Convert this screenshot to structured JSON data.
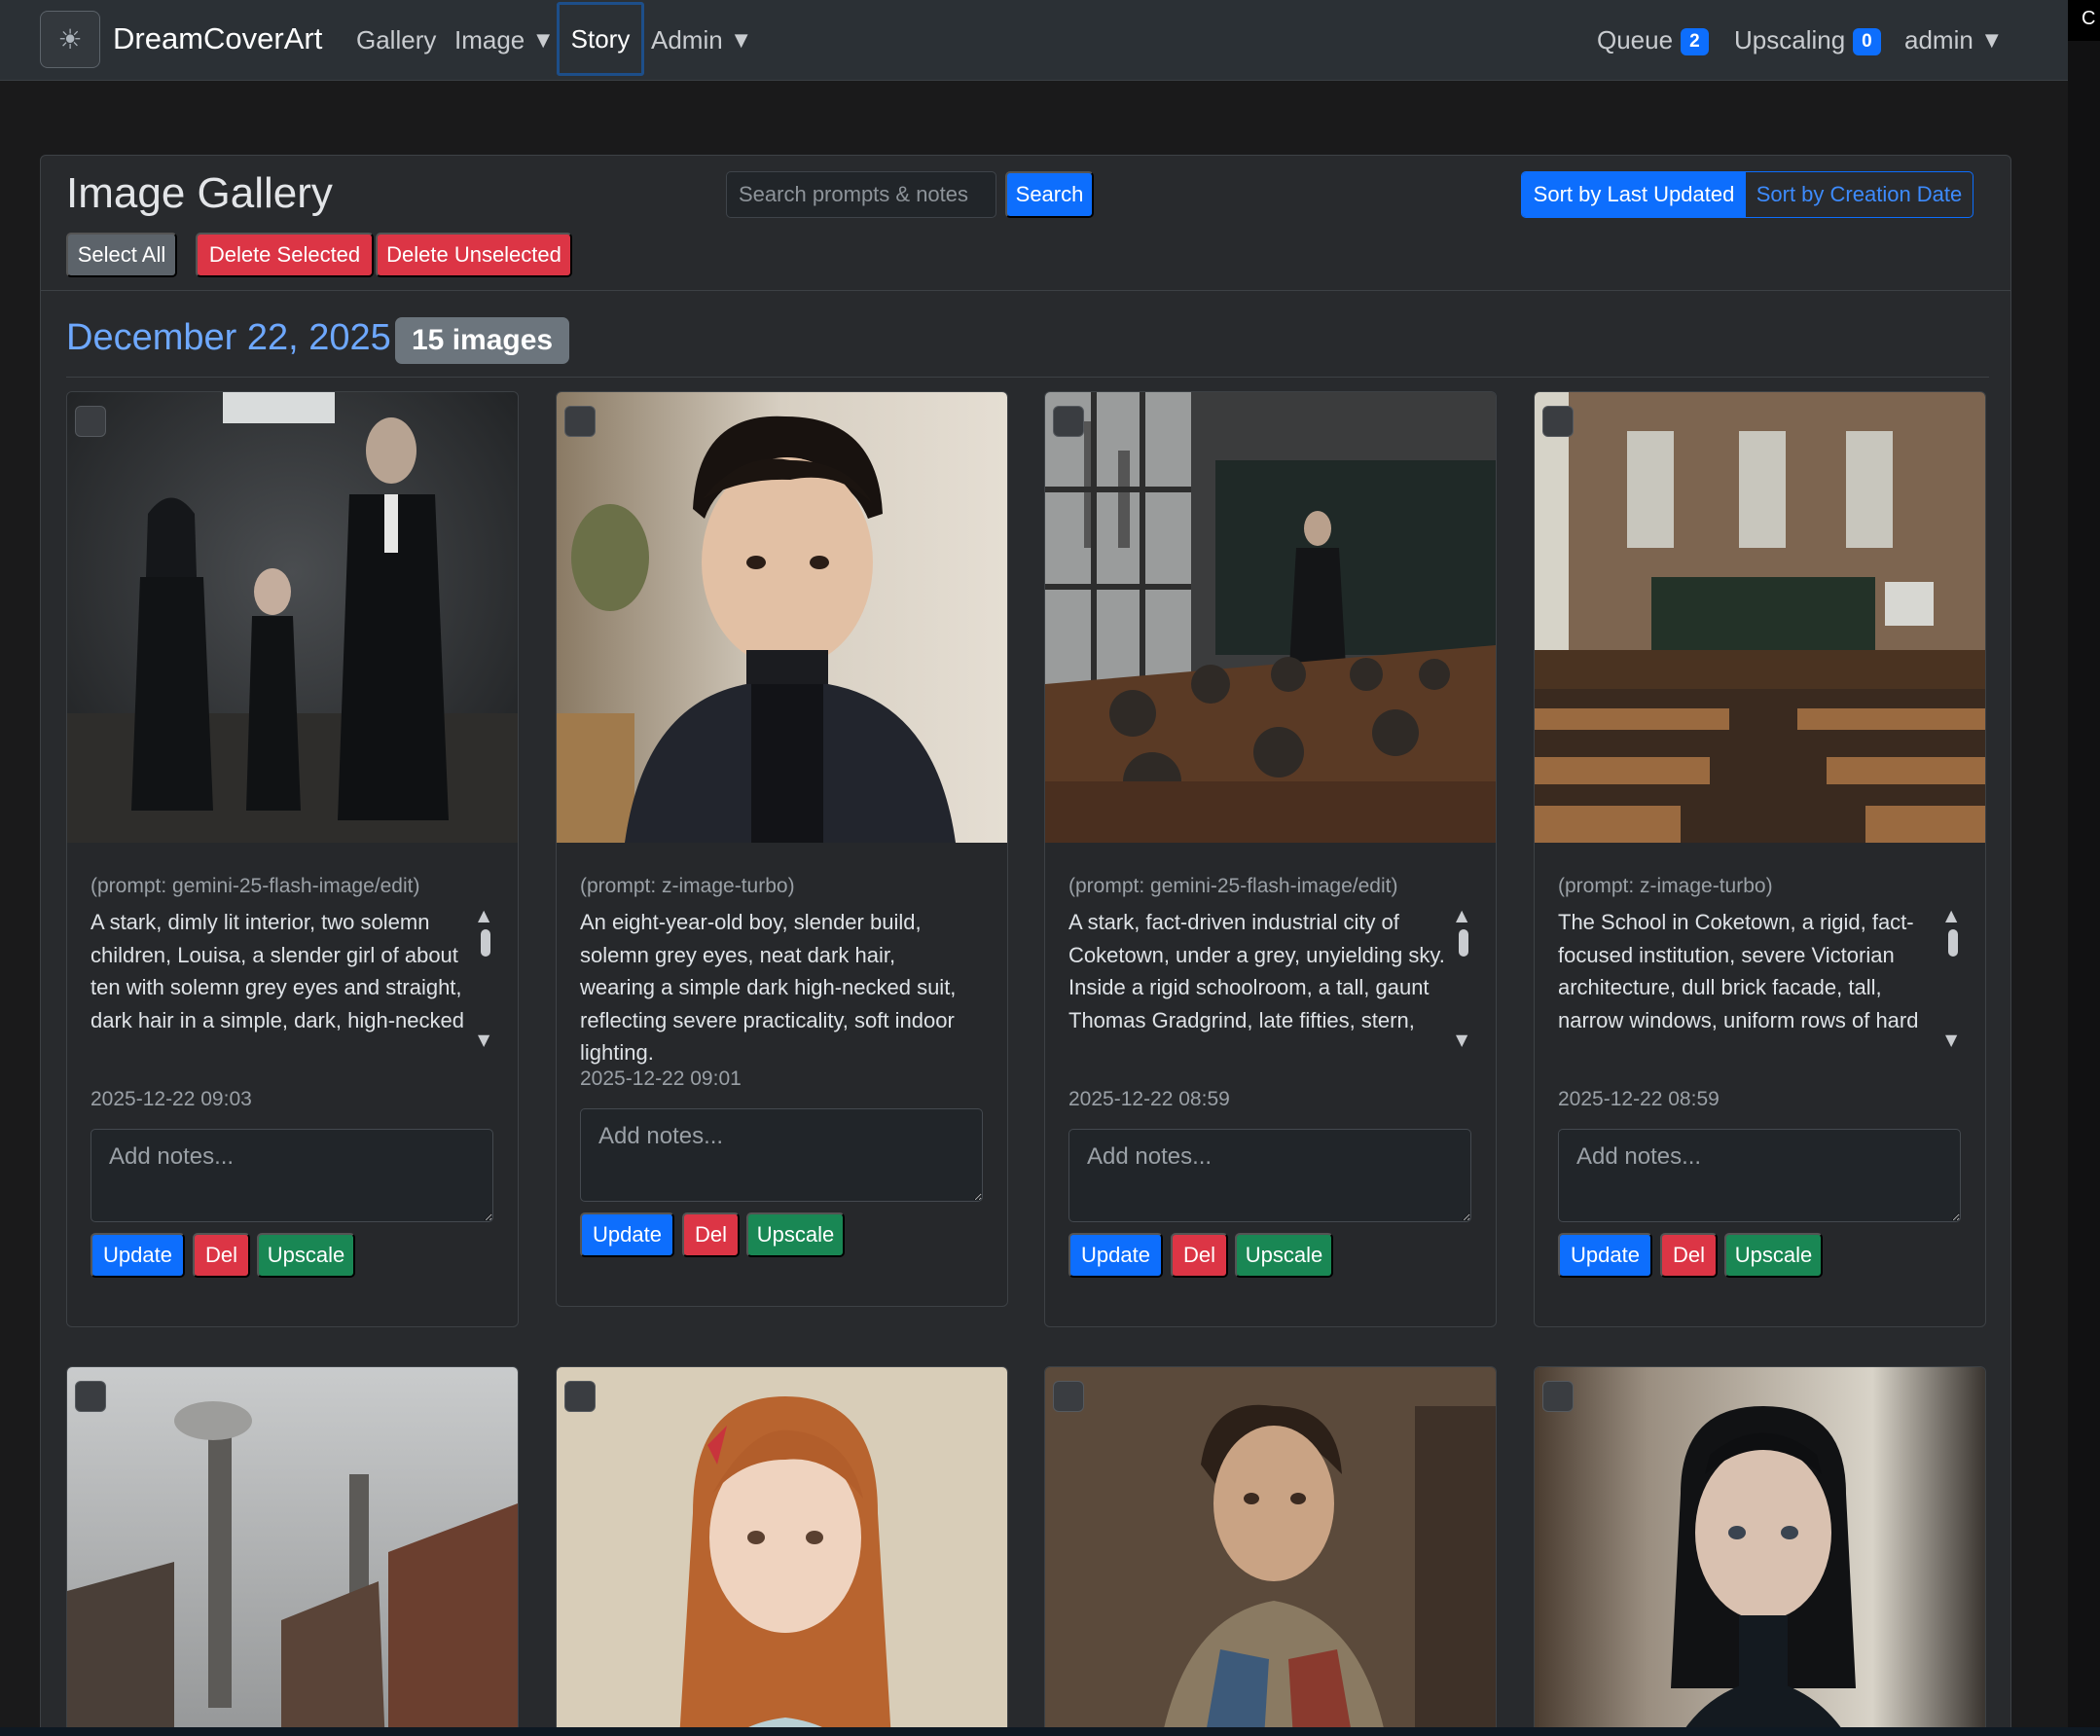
{
  "navbar": {
    "brand_icon": "sun-icon",
    "brand": "DreamCoverArt",
    "links": {
      "gallery": "Gallery",
      "image": "Image",
      "story": "Story",
      "admin": "Admin"
    },
    "queue_label": "Queue",
    "queue_count": "2",
    "upscaling_label": "Upscaling",
    "upscaling_count": "0",
    "user": "admin",
    "corner_text": "C"
  },
  "page": {
    "title": "Image Gallery",
    "select_all": "Select All",
    "delete_selected": "Delete Selected",
    "delete_unselected": "Delete Unselected",
    "search_placeholder": "Search prompts & notes",
    "search_button": "Search",
    "sort_last_updated": "Sort by Last Updated",
    "sort_creation_date": "Sort by Creation Date"
  },
  "group": {
    "date": "December 22, 2025",
    "count": "15 images"
  },
  "card_actions": {
    "notes_placeholder": "Add notes...",
    "update": "Update",
    "del": "Del",
    "upscale": "Upscale"
  },
  "cards": [
    {
      "image": "family-portrait-dim-interior",
      "prompt_label": "(prompt: gemini-25-flash-image/edit)",
      "prompt": "A stark, dimly lit interior, two solemn children, Louisa, a slender girl of about ten with solemn grey eyes and straight, dark hair in a simple, dark, high-necked dress, and Tom, a slender boy",
      "timestamp": "2025-12-22 09:03"
    },
    {
      "image": "boy-portrait-dark-suit",
      "prompt_label": "(prompt: z-image-turbo)",
      "prompt": "An eight-year-old boy, slender build, solemn grey eyes, neat dark hair, wearing a simple dark high-necked suit, reflecting severe practicality, soft indoor lighting.",
      "timestamp": "2025-12-22 09:01"
    },
    {
      "image": "victorian-schoolroom-teacher",
      "prompt_label": "(prompt: gemini-25-flash-image/edit)",
      "prompt": "A stark, fact-driven industrial city of Coketown, under a grey, unyielding sky. Inside a rigid schoolroom, a tall, gaunt Thomas Gradgrind, late fifties, stern, angular face, sharp grey eyes",
      "timestamp": "2025-12-22 08:59"
    },
    {
      "image": "empty-victorian-classroom",
      "prompt_label": "(prompt: z-image-turbo)",
      "prompt": "The School in Coketown, a rigid, fact-focused institution, severe Victorian architecture, dull brick facade, tall, narrow windows, uniform rows of hard wooden desks, a stark, unadorned",
      "timestamp": "2025-12-22 08:59"
    },
    {
      "image": "industrial-chimneys-street"
    },
    {
      "image": "red-haired-girl-portrait"
    },
    {
      "image": "ragged-man-portrait"
    },
    {
      "image": "dark-haired-girl-portrait"
    }
  ]
}
